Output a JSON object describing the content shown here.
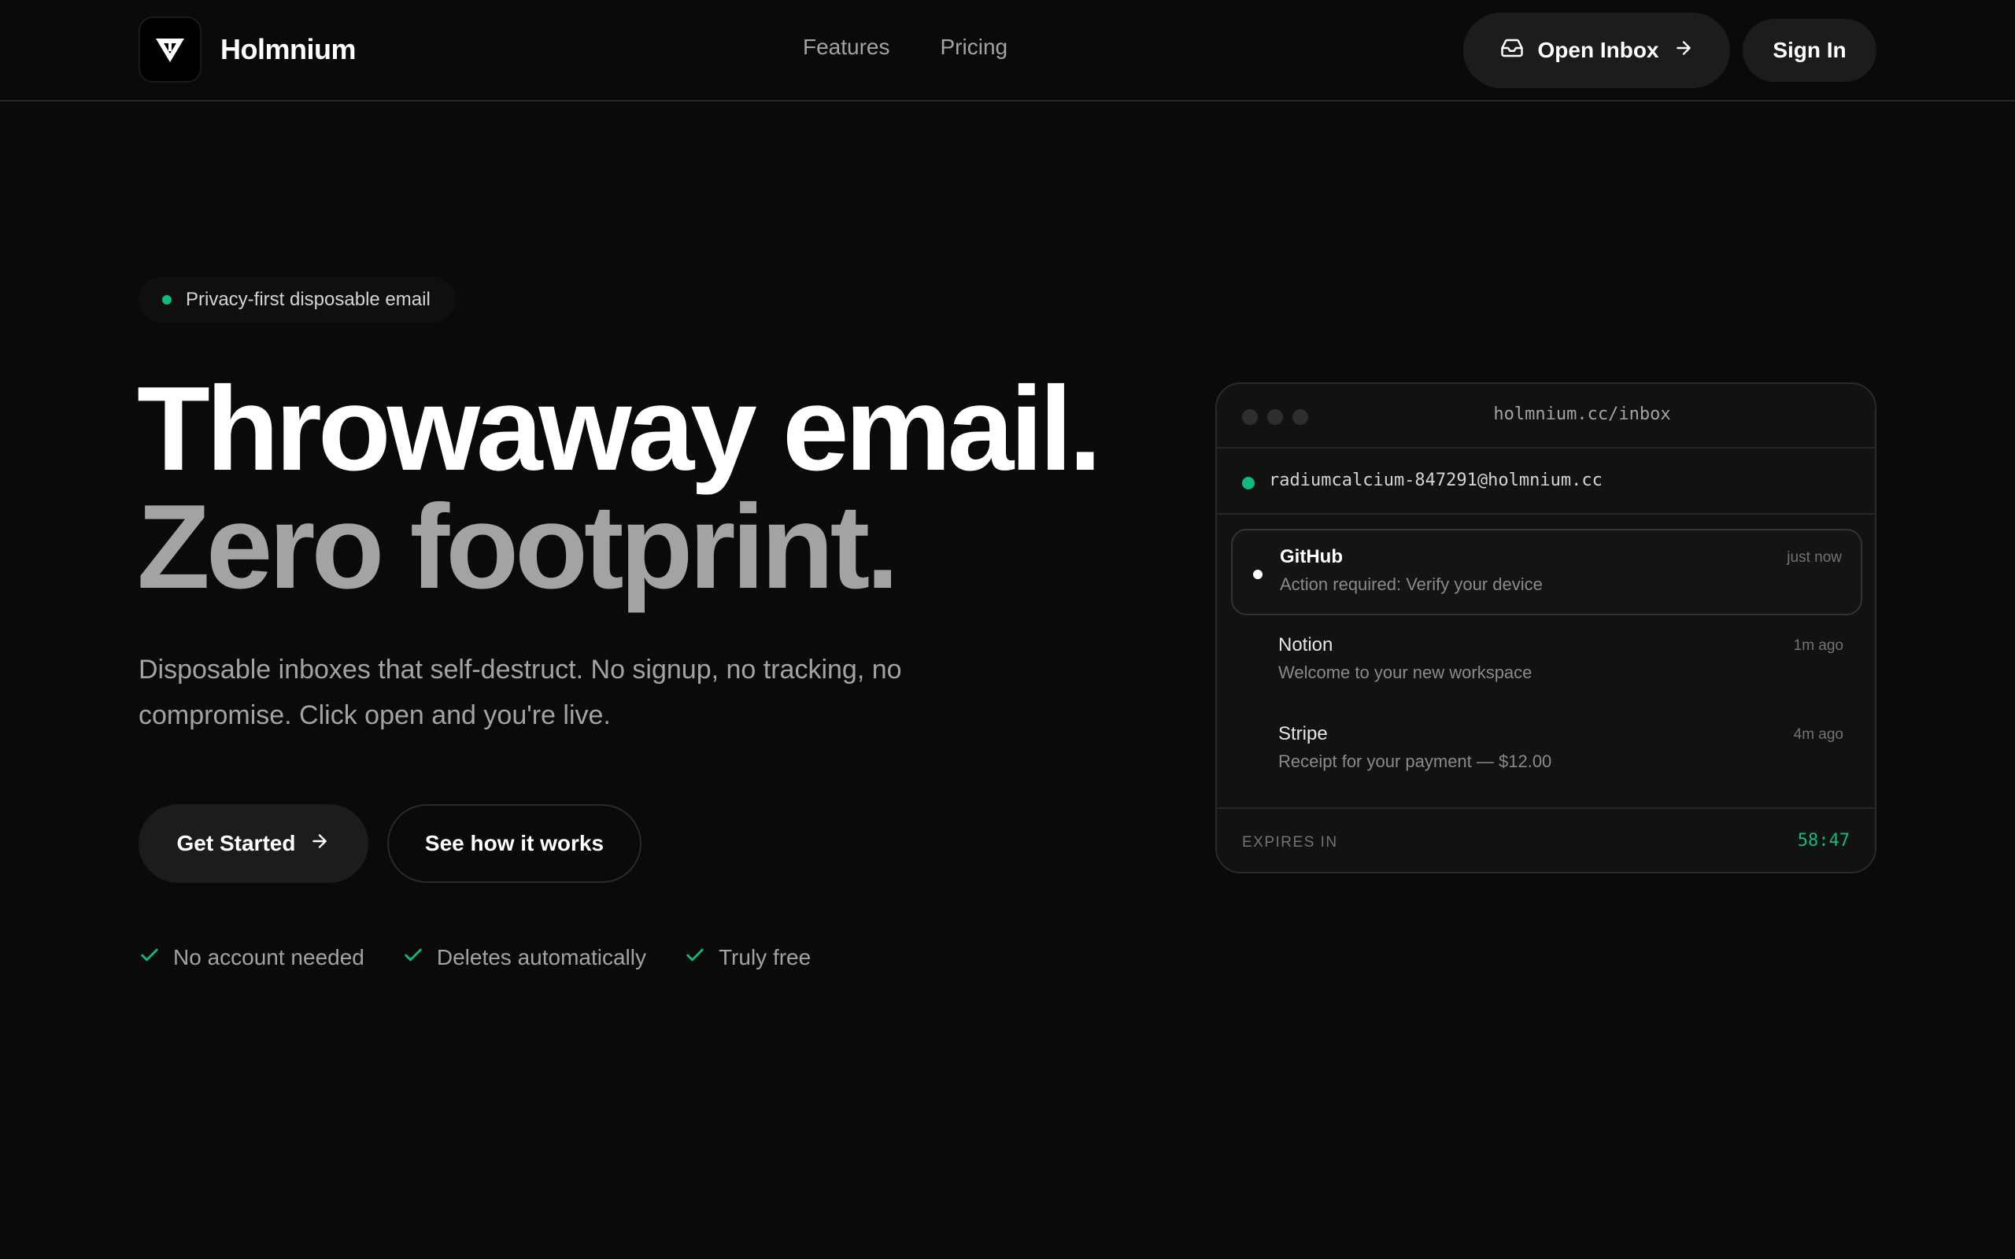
{
  "brand": {
    "name": "Holmnium"
  },
  "nav": {
    "links": [
      "Features",
      "Pricing"
    ],
    "open_inbox": "Open Inbox",
    "sign_in": "Sign In"
  },
  "hero": {
    "badge": "Privacy-first disposable email",
    "title_line1": "Throwaway email.",
    "title_line2": "Zero footprint.",
    "subtitle": "Disposable inboxes that self-destruct. No signup, no tracking, no compromise. Click open and you're live.",
    "cta_primary": "Get Started",
    "cta_secondary": "See how it works",
    "checks": [
      "No account needed",
      "Deletes automatically",
      "Truly free"
    ]
  },
  "inbox_preview": {
    "url": "holmnium.cc/inbox",
    "address": "radiumcalcium-847291@holmnium.cc",
    "messages": [
      {
        "from": "GitHub",
        "subject": "Action required: Verify your device",
        "time": "just now"
      },
      {
        "from": "Notion",
        "subject": "Welcome to your new workspace",
        "time": "1m ago"
      },
      {
        "from": "Stripe",
        "subject": "Receipt for your payment — $12.00",
        "time": "4m ago"
      }
    ],
    "expires_label": "EXPIRES IN",
    "expires_time": "58:47"
  },
  "colors": {
    "accent": "#10b981",
    "background": "#0a0a0a",
    "surface": "#1c1c1c"
  },
  "icons": {
    "logo": "holmnium-logo-icon",
    "inbox": "inbox-icon",
    "arrow": "arrow-right-icon",
    "check": "check-icon"
  }
}
